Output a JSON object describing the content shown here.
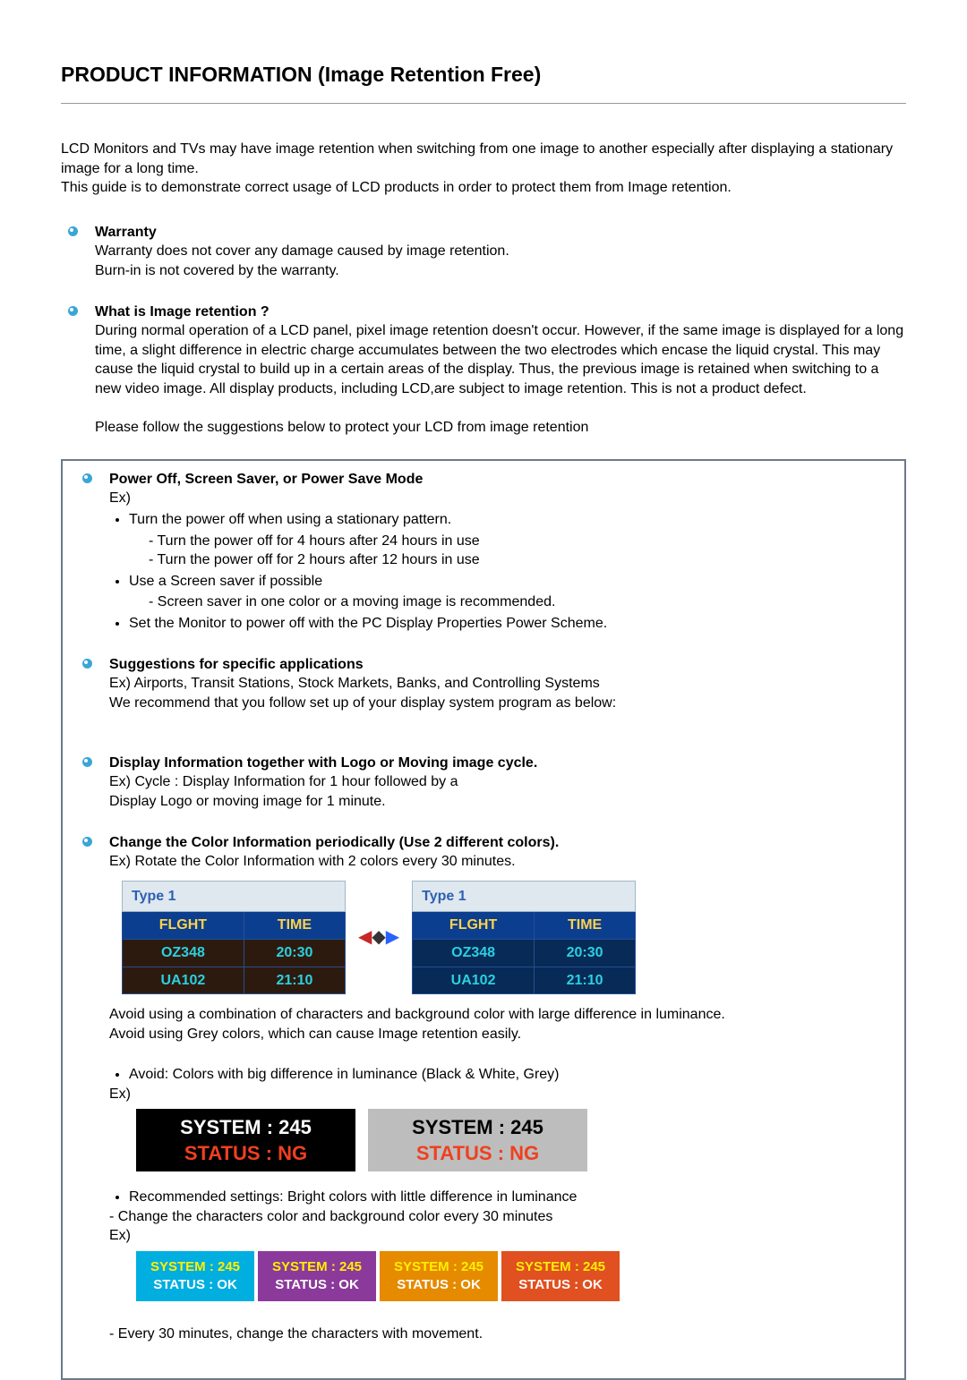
{
  "title": "PRODUCT INFORMATION (Image Retention Free)",
  "intro1": "LCD Monitors and TVs may have image retention when switching from one image to another especially after displaying a stationary image for a long time.",
  "intro2": "This guide is to demonstrate correct usage of LCD products in order to protect them from Image retention.",
  "warranty": {
    "h": "Warranty",
    "p1": "Warranty does not cover any damage caused by image retention.",
    "p2": "Burn-in is not covered by the warranty."
  },
  "what": {
    "h": "What is Image retention ?",
    "p": "During normal operation of a LCD panel, pixel image retention doesn't occur. However, if the same image is displayed for a long time, a slight difference in electric charge accumulates between the two electrodes which encase the liquid crystal. This may cause the liquid crystal to build up in a certain areas of the display. Thus, the previous image is retained when switching to a new video image. All display products, including LCD,are subject to image retention. This is not a product defect.",
    "p2": "Please follow the suggestions below to protect your LCD from image retention"
  },
  "power": {
    "h": "Power Off, Screen Saver, or Power Save Mode",
    "ex": "Ex)",
    "li1": "Turn the power off when using a stationary pattern.",
    "li1a": "Turn the power off for 4 hours after 24 hours in use",
    "li1b": "Turn the power off for 2 hours after 12 hours in use",
    "li2": "Use a Screen saver if possible",
    "li2a": "Screen saver in one color or a moving image is recommended.",
    "li3": "Set the Monitor to power off with the PC Display Properties Power Scheme."
  },
  "sugg": {
    "h": "Suggestions for specific applications",
    "p1": "Ex) Airports, Transit Stations, Stock Markets, Banks, and Controlling Systems",
    "p2": "We recommend that you follow set up of your display system program as below:"
  },
  "disp": {
    "h": "Display Information together with Logo or Moving image cycle.",
    "p1": "Ex) Cycle : Display Information for 1 hour followed by a",
    "p2": "Display Logo or moving image for 1 minute."
  },
  "change": {
    "h": "Change the Color Information periodically (Use 2 different colors).",
    "p": "Ex) Rotate the Color Information with 2 colors every 30 minutes."
  },
  "flight": {
    "title": "Type 1",
    "hd1": "FLGHT",
    "hd2": "TIME",
    "r1a": "OZ348",
    "r1b": "20:30",
    "r2a": "UA102",
    "r2b": "21:10"
  },
  "after": {
    "p1": "Avoid using a combination of characters and background color with large difference in luminance.",
    "p2": "Avoid using Grey colors, which can cause Image retention easily.",
    "li": "Avoid: Colors with big difference in luminance (Black & White, Grey)",
    "ex": "Ex)"
  },
  "sys": {
    "l1": "SYSTEM : 245",
    "l2": "STATUS : NG"
  },
  "rec": {
    "li": "Recommended settings: Bright colors with little difference in luminance",
    "d1": "- Change the characters color and background color every 30 minutes",
    "ex": "Ex)"
  },
  "small": {
    "l1": "SYSTEM : 245",
    "l2": "STATUS : OK"
  },
  "last": "- Every 30 minutes, change the characters with movement."
}
